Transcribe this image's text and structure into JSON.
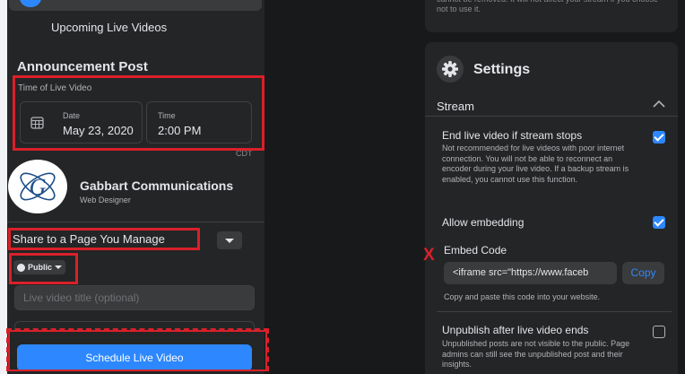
{
  "left_nav": {
    "upcoming_label": "Upcoming Live Videos"
  },
  "announcement": {
    "section_title": "Announcement Post",
    "time_label": "Time of Live Video",
    "date_label": "Date",
    "date_value": "May 23, 2020",
    "time_field_label": "Time",
    "time_value": "2:00 PM",
    "timezone": "CDT"
  },
  "page": {
    "name": "Gabbart Communications",
    "role": "Web Designer",
    "logo_letter": "G"
  },
  "share": {
    "label": "Share to a Page You Manage",
    "audience": "Public"
  },
  "title_input": {
    "placeholder": "Live video title (optional)"
  },
  "schedule_button": "Schedule Live Video",
  "settings_top_text": "cannot be removed. It will not affect your stream if you choose not to use it.",
  "settings": {
    "title": "Settings",
    "stream_label": "Stream",
    "end_live": {
      "title": "End live video if stream stops",
      "desc": "Not recommended for live videos with poor internet connection. You will not be able to reconnect an encoder during your live video. If a backup stream is enabled, you cannot use this function.",
      "checked": true
    },
    "allow_embedding": {
      "title": "Allow embedding",
      "checked": true
    },
    "embed_code": {
      "label": "Embed Code",
      "value": "<iframe src=\"https://www.faceb",
      "copy_label": "Copy",
      "help": "Copy and paste this code into your website."
    },
    "unpublish": {
      "title": "Unpublish after live video ends",
      "desc": "Unpublished posts are not visible to the public. Page admins can still see the unpublished post and their insights.",
      "checked": false
    }
  },
  "annotation": {
    "x_mark": "X"
  },
  "colors": {
    "accent": "#2d88ff",
    "annotation_red": "#d9202a",
    "panel": "#242526",
    "background": "#18191a"
  }
}
